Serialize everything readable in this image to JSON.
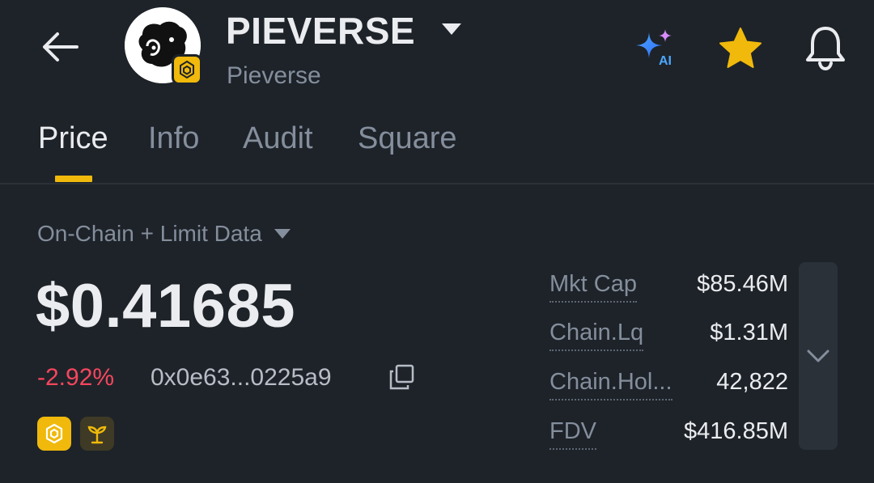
{
  "header": {
    "token_symbol": "PIEVERSE",
    "token_name": "Pieverse",
    "ai_label": "AI"
  },
  "tabs": [
    {
      "label": "Price",
      "active": true
    },
    {
      "label": "Info",
      "active": false
    },
    {
      "label": "Audit",
      "active": false
    },
    {
      "label": "Square",
      "active": false
    }
  ],
  "market": {
    "data_mode": "On-Chain + Limit Data",
    "price": "$0.41685",
    "change": "-2.92%",
    "contract_address": "0x0e63...0225a9"
  },
  "stats": [
    {
      "label": "Mkt Cap",
      "value": "$85.46M"
    },
    {
      "label": "Chain.Lq",
      "value": "$1.31M"
    },
    {
      "label": "Chain.Hol...",
      "value": "42,822"
    },
    {
      "label": "FDV",
      "value": "$416.85M"
    }
  ],
  "colors": {
    "background": "#1e2329",
    "accent": "#f0b90b",
    "negative": "#f6465d",
    "text_primary": "#eaecef",
    "text_secondary": "#848e9c"
  },
  "icons": {
    "back": "arrow-left-icon",
    "ai": "ai-sparkle-icon",
    "favorite": "star-icon",
    "alert": "bell-icon",
    "copy": "copy-icon",
    "expand": "chevron-down-icon",
    "chain": "bnb-chain-icon",
    "sprout": "sprout-icon"
  }
}
